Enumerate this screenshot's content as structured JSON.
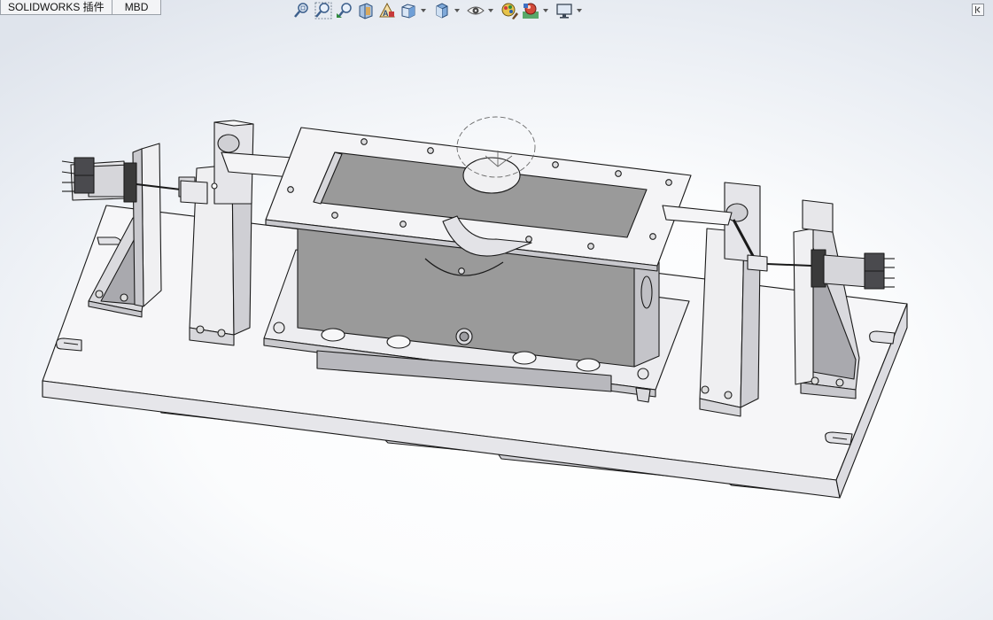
{
  "tabs": [
    {
      "label": "SOLIDWORKS 插件"
    },
    {
      "label": "MBD"
    }
  ],
  "heads_up_toolbar": {
    "buttons": [
      {
        "icon": "zoom-to-fit-icon"
      },
      {
        "icon": "zoom-to-area-icon"
      },
      {
        "icon": "previous-view-icon"
      },
      {
        "icon": "section-view-icon"
      },
      {
        "icon": "dynamic-annotation-views-icon"
      },
      {
        "icon": "view-orientation-icon",
        "dropdown": true
      },
      {
        "icon": "display-style-icon",
        "dropdown": true
      },
      {
        "icon": "hide-show-items-icon",
        "dropdown": true
      },
      {
        "icon": "edit-appearance-icon"
      },
      {
        "icon": "apply-scene-icon",
        "dropdown": true
      },
      {
        "icon": "view-settings-icon",
        "dropdown": true
      }
    ]
  },
  "colors": {
    "part_fill": "#f2f2f4",
    "part_shadow": "#c9c9cf",
    "cavity": "#9a9a9a",
    "edge": "#1a1a1a"
  },
  "graphics_area": {
    "model": "welding-fixture-assembly"
  }
}
